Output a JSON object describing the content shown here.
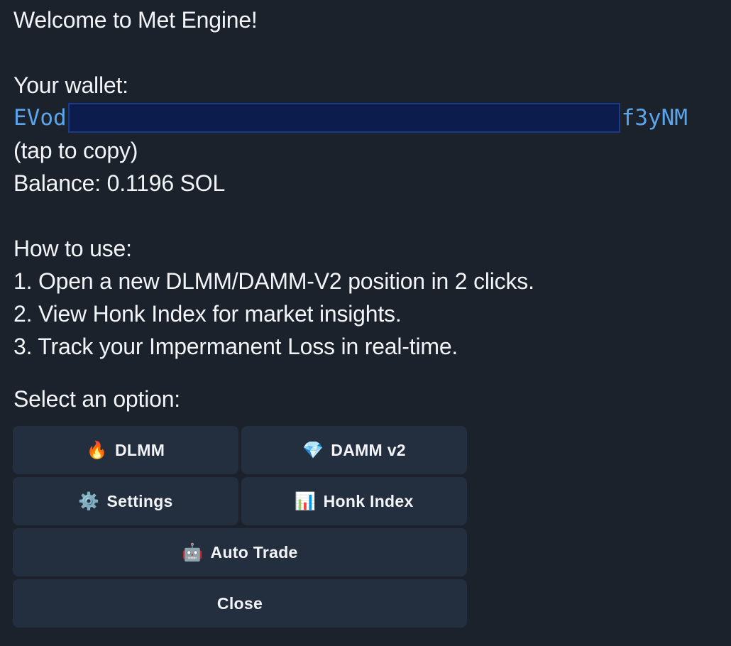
{
  "message": {
    "welcome": "Welcome to Met Engine!",
    "wallet_label": "Your wallet:",
    "wallet_prefix": "EVod",
    "wallet_suffix": "f3yNM",
    "tap_hint": "(tap to copy)",
    "balance": "Balance: 0.1196 SOL",
    "how_to_title": "How to use:",
    "steps": [
      "1. Open a new DLMM/DAMM-V2 position in 2 clicks.",
      "2. View Honk Index for market insights.",
      "3. Track your Impermanent Loss in real-time."
    ],
    "select_prompt": "Select an option:"
  },
  "keyboard": {
    "dlmm": {
      "icon": "🔥",
      "label": "DLMM"
    },
    "damm": {
      "icon": "💎",
      "label": "DAMM v2"
    },
    "settings": {
      "icon": "⚙️",
      "label": "Settings"
    },
    "honk": {
      "icon": "📊",
      "label": "Honk Index"
    },
    "auto_trade": {
      "icon": "🤖",
      "label": "Auto Trade"
    },
    "close": {
      "label": "Close"
    }
  },
  "colors": {
    "background": "#1b222c",
    "button": "#232e3e",
    "monospace_link": "#5aa5ec",
    "redaction": "#0b1c4d"
  }
}
